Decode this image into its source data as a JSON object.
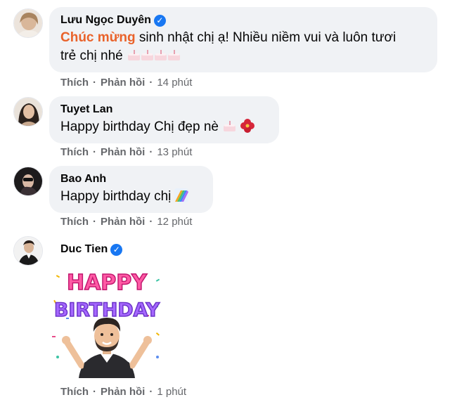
{
  "comments": [
    {
      "name": "Lưu Ngọc Duyên",
      "verified": true,
      "text_highlight": "Chúc mừng",
      "text_line1": " sinh nhật chị ạ! Nhiều niềm vui và luôn tươi",
      "text_line2": "trẻ chị nhé",
      "emojis": [
        "birthday-cake",
        "birthday-cake",
        "birthday-cake",
        "birthday-cake"
      ],
      "like": "Thích",
      "reply": "Phản hồi",
      "time": "14 phút"
    },
    {
      "name": "Tuyet Lan",
      "verified": false,
      "text": "Happy birthday Chị đẹp nè",
      "emojis": [
        "birthday-cake",
        "hibiscus"
      ],
      "like": "Thích",
      "reply": "Phản hồi",
      "time": "13 phút"
    },
    {
      "name": "Bao Anh",
      "verified": false,
      "text": "Happy birthday chị",
      "emojis": [
        "rainbow"
      ],
      "like": "Thích",
      "reply": "Phản hồi",
      "time": "12 phút"
    },
    {
      "name": "Duc Tien",
      "verified": true,
      "sticker": {
        "word1": "HAPPY",
        "word2": "BIRTHDAY"
      },
      "like": "Thích",
      "reply": "Phản hồi",
      "time": "1 phút"
    }
  ],
  "colors": {
    "bubble": "#f0f2f5",
    "highlight": "#e9622a",
    "meta": "#65676b",
    "verified": "#1877f2"
  },
  "separator": "·"
}
